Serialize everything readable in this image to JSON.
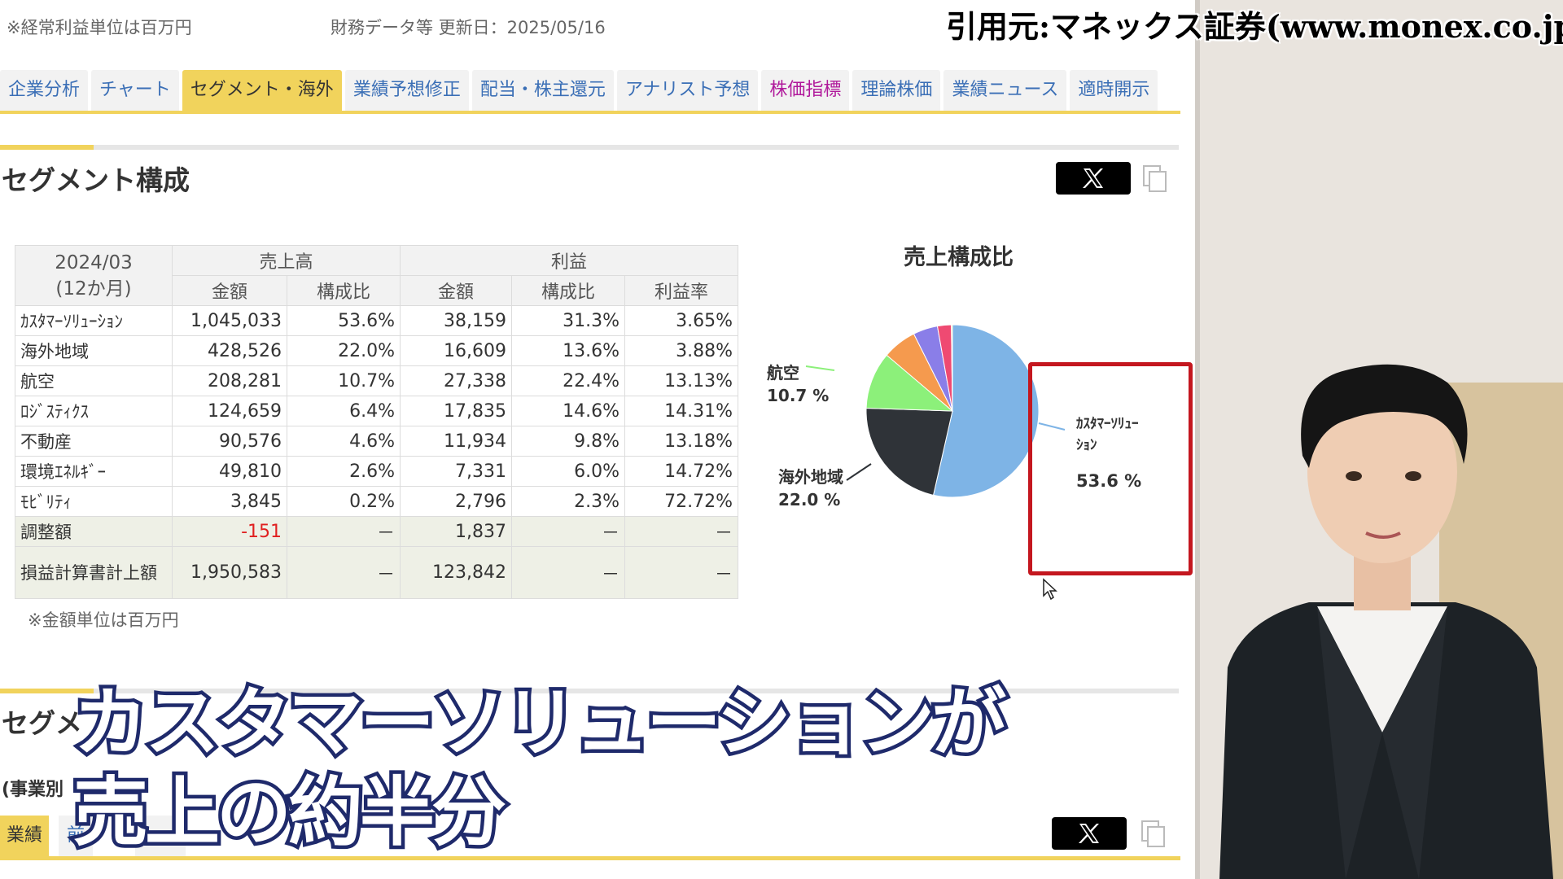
{
  "header": {
    "unit_note": "※経常利益単位は百万円",
    "updated": "財務データ等 更新日：2025/05/16"
  },
  "citation": "引用元:マネックス証券(www.monex.co.jp)",
  "tabs": [
    {
      "label": "企業分析",
      "state": "normal"
    },
    {
      "label": "チャート",
      "state": "normal"
    },
    {
      "label": "セグメント・海外",
      "state": "active"
    },
    {
      "label": "業績予想修正",
      "state": "normal"
    },
    {
      "label": "配当・株主還元",
      "state": "normal"
    },
    {
      "label": "アナリスト予想",
      "state": "normal"
    },
    {
      "label": "株価指標",
      "state": "pink"
    },
    {
      "label": "理論株価",
      "state": "normal"
    },
    {
      "label": "業績ニュース",
      "state": "normal"
    },
    {
      "label": "適時開示",
      "state": "normal"
    }
  ],
  "segment": {
    "title": "セグメント構成",
    "table": {
      "period": "2024/03",
      "period_sub": "(12か月)",
      "group_sales": "売上高",
      "group_profit": "利益",
      "col_amount": "金額",
      "col_ratio": "構成比",
      "col_margin": "利益率",
      "rows": [
        {
          "label": "ｶｽﾀﾏｰｿﾘｭｰｼｮﾝ",
          "sales": "1,045,033",
          "sales_ratio": "53.6%",
          "profit": "38,159",
          "profit_ratio": "31.3%",
          "margin": "3.65%"
        },
        {
          "label": "海外地域",
          "sales": "428,526",
          "sales_ratio": "22.0%",
          "profit": "16,609",
          "profit_ratio": "13.6%",
          "margin": "3.88%"
        },
        {
          "label": "航空",
          "sales": "208,281",
          "sales_ratio": "10.7%",
          "profit": "27,338",
          "profit_ratio": "22.4%",
          "margin": "13.13%"
        },
        {
          "label": "ﾛｼﾞｽﾃｨｸｽ",
          "sales": "124,659",
          "sales_ratio": "6.4%",
          "profit": "17,835",
          "profit_ratio": "14.6%",
          "margin": "14.31%"
        },
        {
          "label": "不動産",
          "sales": "90,576",
          "sales_ratio": "4.6%",
          "profit": "11,934",
          "profit_ratio": "9.8%",
          "margin": "13.18%"
        },
        {
          "label": "環境ｴﾈﾙｷﾞｰ",
          "sales": "49,810",
          "sales_ratio": "2.6%",
          "profit": "7,331",
          "profit_ratio": "6.0%",
          "margin": "14.72%"
        },
        {
          "label": "ﾓﾋﾞﾘﾃｨ",
          "sales": "3,845",
          "sales_ratio": "0.2%",
          "profit": "2,796",
          "profit_ratio": "2.3%",
          "margin": "72.72%"
        }
      ],
      "adjustment": {
        "label": "調整額",
        "sales": "-151",
        "sales_ratio": "－",
        "profit": "1,837",
        "profit_ratio": "－",
        "margin": "－"
      },
      "total": {
        "label": "損益計算書計上額",
        "sales": "1,950,583",
        "sales_ratio": "－",
        "profit": "123,842",
        "profit_ratio": "－",
        "margin": "－"
      }
    },
    "amount_note": "※金額単位は百万円"
  },
  "chart_data": {
    "type": "pie",
    "title": "売上構成比",
    "slices": [
      {
        "label": "ｶｽﾀﾏｰｿﾘｭｰｼｮﾝ",
        "value": 53.6,
        "color": "#7eb4e6"
      },
      {
        "label": "海外地域",
        "value": 22.0,
        "color": "#2f3338"
      },
      {
        "label": "航空",
        "value": 10.7,
        "color": "#8cf07a"
      },
      {
        "label": "ﾛｼﾞｽﾃｨｸｽ",
        "value": 6.4,
        "color": "#f59a4e"
      },
      {
        "label": "不動産",
        "value": 4.6,
        "color": "#8a7ee8"
      },
      {
        "label": "環境ｴﾈﾙｷﾞｰ",
        "value": 2.6,
        "color": "#ef4a72"
      },
      {
        "label": "ﾓﾋﾞﾘﾃｨ",
        "value": 0.2,
        "color": "#e6d85c"
      }
    ],
    "labels_shown": [
      {
        "name": "航空",
        "value": "10.7 %"
      },
      {
        "name": "海外地域",
        "value": "22.0 %"
      },
      {
        "name": "ｶｽﾀﾏｰｿﾘｭｰ",
        "name2": "ｼｮﾝ",
        "value": "53.6 %"
      }
    ]
  },
  "segment2": {
    "title": "セグメ",
    "sub": "(事業別",
    "tab_active": "業績",
    "tab_next": "前"
  },
  "caption": {
    "line1": "カスタマーソリューションが",
    "line2": "売上の約半分"
  },
  "colors": {
    "accent": "#f1d35c",
    "link": "#3b6fb6",
    "highlight": "#c4171f",
    "caption_stroke": "#1f2a6b"
  }
}
